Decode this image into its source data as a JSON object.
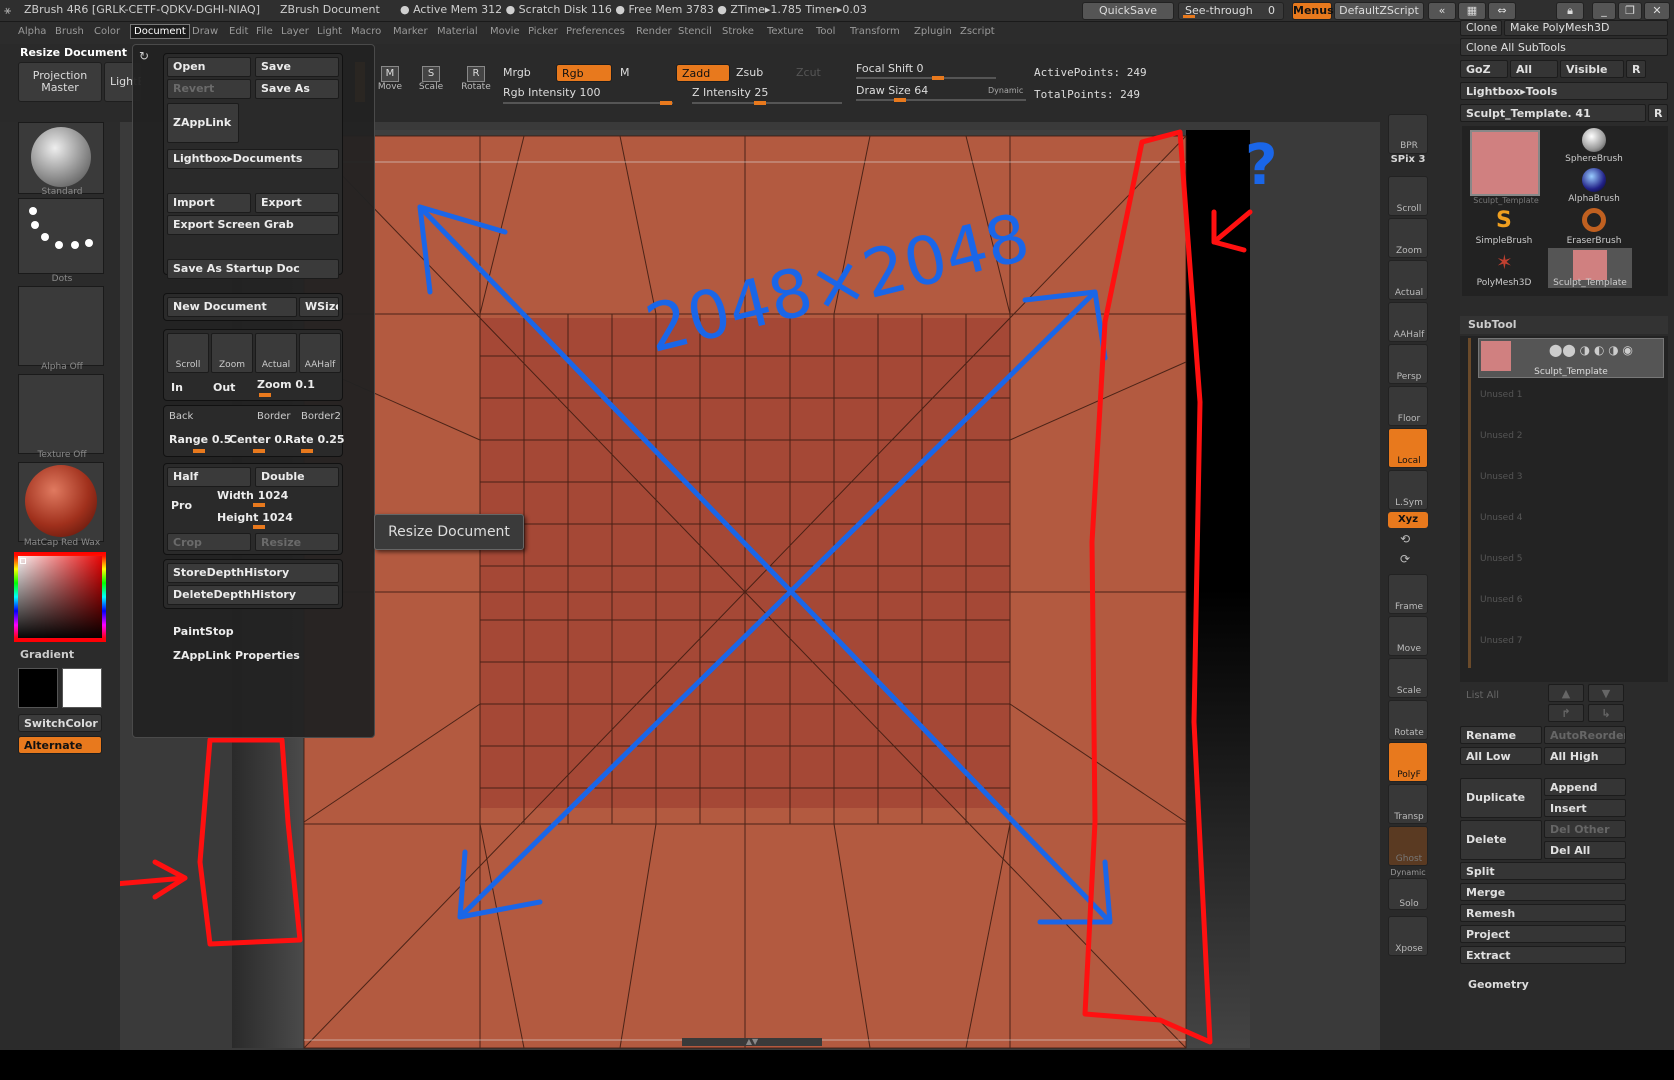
{
  "titlebar": {
    "app": "ZBrush 4R6 [GRLK-CETF-QDKV-DGHI-NIAQ]",
    "doc": "ZBrush Document",
    "stats": "● Active Mem 312 ● Scratch Disk 116 ● Free Mem 3783 ● ZTime▸1.785 Timer▸0.03",
    "quicksave": "QuickSave",
    "seethrough": "See-through",
    "seethrough_value": "0",
    "menus": "Menus",
    "defaultzscript": "DefaultZScript"
  },
  "menubar": [
    "Alpha",
    "Brush",
    "Color",
    "Document",
    "Draw",
    "Edit",
    "File",
    "Layer",
    "Light",
    "Macro",
    "Marker",
    "Material",
    "Movie",
    "Picker",
    "Preferences",
    "Render",
    "Stencil",
    "Stroke",
    "Texture",
    "Tool",
    "Transform",
    "Zplugin",
    "Zscript"
  ],
  "menubar_active": "Document",
  "toolbar": {
    "resize_document": "Resize Document",
    "projection_master": "Projection Master",
    "lightbox": "LightBox",
    "icons": [
      "Move",
      "Scale",
      "Rotate"
    ],
    "mrgb": "Mrgb",
    "rgb": "Rgb",
    "m": "M",
    "zadd": "Zadd",
    "zsub": "Zsub",
    "zcut": "Zcut",
    "rgb_intensity": "Rgb Intensity 100",
    "z_intensity": "Z Intensity 25",
    "focal_shift": "Focal Shift 0",
    "draw_size": "Draw Size 64",
    "dynamic": "Dynamic",
    "active_points": "ActivePoints: 249",
    "total_points": "TotalPoints: 249"
  },
  "leftshelf": {
    "brush": "Standard",
    "stroke": "Dots",
    "alpha": "Alpha Off",
    "texture": "Texture Off",
    "material": "MatCap Red Wax",
    "gradient": "Gradient",
    "switchcolor": "SwitchColor",
    "alternate": "Alternate",
    "colors": {
      "primary": "#000000",
      "secondary": "#ffffff",
      "material": "#a0301c"
    }
  },
  "docmenu": {
    "open": "Open",
    "save": "Save",
    "revert": "Revert",
    "save_as": "Save As",
    "zapplink": "ZAppLink",
    "lightbox_documents": "Lightbox▸Documents",
    "import": "Import",
    "export": "Export",
    "export_screen_grab": "Export Screen Grab",
    "save_as_startup_doc": "Save As Startup Doc",
    "new_document": "New Document",
    "wsize": "WSize",
    "nav_icons": [
      "Scroll",
      "Zoom",
      "Actual",
      "AAHalf"
    ],
    "in": "In",
    "out": "Out",
    "zoom": "Zoom",
    "zoom_value": "0.1",
    "back": "Back",
    "border": "Border",
    "border2": "Border2",
    "range": "Range 0.5",
    "center": "Center 0.",
    "rate": "Rate 0.25",
    "half": "Half",
    "double": "Double",
    "pro": "Pro",
    "width_label": "Width",
    "width_value": "1024",
    "height_label": "Height",
    "height_value": "1024",
    "crop": "Crop",
    "resize": "Resize",
    "store_depth": "StoreDepthHistory",
    "delete_depth": "DeleteDepthHistory",
    "paintstop": "PaintStop",
    "zapplink_properties": "ZAppLink Properties"
  },
  "tooltip": "Resize Document",
  "annotation": {
    "size_text": "2048×2048",
    "question_mark": "?"
  },
  "right_icons": [
    "BPR",
    "SPix 3",
    "Scroll",
    "Zoom",
    "Actual",
    "AAHalf",
    "Persp",
    "Floor",
    "Local",
    "L.Sym",
    "Xyz",
    "Frame",
    "Move",
    "Scale",
    "Rotate",
    "PolyF",
    "Transp",
    "Ghost",
    "Dynamic",
    "Solo",
    "Xpose"
  ],
  "rightpanel": {
    "clone": "Clone",
    "make_polymesh": "Make PolyMesh3D",
    "clone_all": "Clone All SubTools",
    "goz": "GoZ",
    "all": "All",
    "visible": "Visible",
    "r": "R",
    "lightbox_tools": "Lightbox▸Tools",
    "sculpt_template": "Sculpt_Template. 41",
    "tools": [
      "Sculpt_Template",
      "SphereBrush",
      "AlphaBrush",
      "SimpleBrush",
      "EraserBrush",
      "PolyMesh3D",
      "Sculpt_Template"
    ],
    "subtool": "SubTool",
    "subtool_item": "Sculpt_Template",
    "unused": [
      "Unused 1",
      "Unused 2",
      "Unused 3",
      "Unused 4",
      "Unused 5",
      "Unused 6",
      "Unused 7"
    ],
    "list_all": "List All",
    "rename": "Rename",
    "autoreorder": "AutoReorder",
    "all_low": "All Low",
    "all_high": "All High",
    "duplicate": "Duplicate",
    "append": "Append",
    "insert": "Insert",
    "delete": "Delete",
    "del_other": "Del Other",
    "del_all": "Del All",
    "split": "Split",
    "merge": "Merge",
    "remesh": "Remesh",
    "project": "Project",
    "extract": "Extract",
    "geometry": "Geometry"
  }
}
